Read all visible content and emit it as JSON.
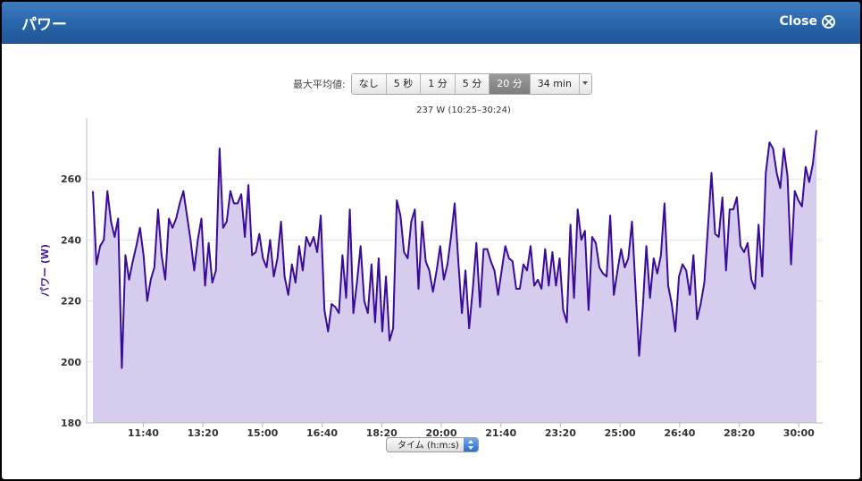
{
  "window": {
    "title": "パワー",
    "close_label": "Close"
  },
  "averaging": {
    "label": "最大平均値:",
    "options": [
      "なし",
      "5 秒",
      "1 分",
      "5 分",
      "20 分",
      "34 min"
    ],
    "selected": "20 分"
  },
  "x_axis_selector": {
    "value": "タイム (h:m:s)"
  },
  "colors": {
    "line": "#3a0a99",
    "fill": "#d6cdee",
    "title_bar": "#2a66ab"
  },
  "chart_data": {
    "type": "area",
    "title": "237 W (10:25–30:24)",
    "ylabel": "パワー (W)",
    "xlabel": "タイム (h:m:s)",
    "ylim": [
      180,
      280
    ],
    "xlim": [
      "10:05",
      "30:40"
    ],
    "yticks": [
      "180",
      "200",
      "220",
      "240",
      "260"
    ],
    "xticks": [
      "11:40",
      "13:20",
      "15:00",
      "16:40",
      "18:20",
      "20:00",
      "21:40",
      "23:20",
      "25:00",
      "26:40",
      "28:20",
      "30:00"
    ],
    "grid": "horizontal",
    "series": [
      {
        "values": [
          256,
          232,
          238,
          240,
          256,
          246,
          241,
          247,
          198,
          235,
          227,
          233,
          238,
          244,
          235,
          220,
          227,
          231,
          250,
          235,
          227,
          247,
          244,
          247,
          252,
          256,
          248,
          240,
          230,
          240,
          247,
          225,
          239,
          226,
          230,
          270,
          244,
          246,
          256,
          252,
          252,
          255,
          241,
          258,
          235,
          236,
          242,
          234,
          231,
          240,
          228,
          234,
          246,
          228,
          222,
          232,
          226,
          238,
          230,
          241,
          238,
          241,
          236,
          248,
          217,
          210,
          219,
          218,
          216,
          235,
          221,
          250,
          216,
          226,
          238,
          220,
          216,
          232,
          213,
          234,
          210,
          228,
          207,
          211,
          253,
          248,
          236,
          234,
          246,
          250,
          224,
          246,
          233,
          230,
          223,
          230,
          238,
          227,
          232,
          241,
          252,
          233,
          216,
          230,
          211,
          224,
          239,
          218,
          237,
          237,
          233,
          230,
          222,
          230,
          238,
          234,
          233,
          224,
          224,
          232,
          230,
          238,
          225,
          227,
          224,
          237,
          225,
          236,
          225,
          234,
          217,
          213,
          245,
          221,
          250,
          240,
          243,
          217,
          241,
          239,
          231,
          229,
          228,
          248,
          222,
          230,
          237,
          231,
          234,
          246,
          224,
          202,
          218,
          238,
          221,
          234,
          229,
          235,
          252,
          225,
          219,
          210,
          228,
          232,
          230,
          222,
          235,
          214,
          219,
          226,
          244,
          262,
          242,
          241,
          254,
          230,
          250,
          250,
          254,
          238,
          236,
          239,
          227,
          224,
          245,
          228,
          262,
          272,
          270,
          262,
          257,
          270,
          261,
          232,
          256,
          253,
          251,
          264,
          259,
          265,
          276
        ]
      }
    ]
  }
}
